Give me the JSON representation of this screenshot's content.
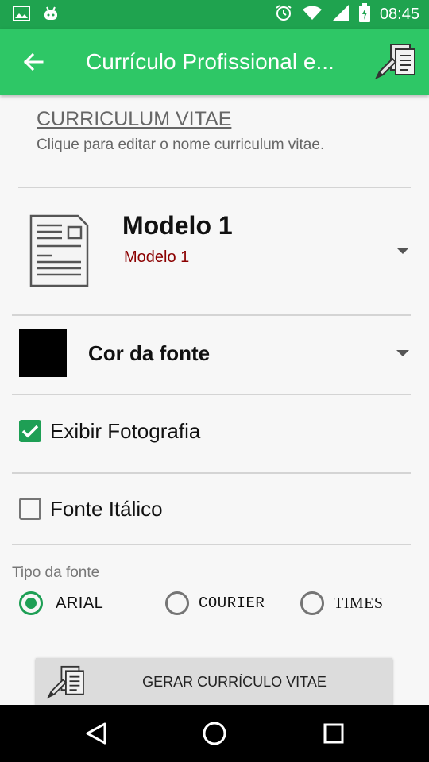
{
  "status_bar": {
    "time": "08:45",
    "icons": [
      "image-icon",
      "android-icon",
      "alarm-icon",
      "wifi-icon",
      "signal-icon",
      "battery-charging-icon"
    ]
  },
  "app_bar": {
    "title": "Currículo Profissional e...",
    "back_icon": "arrow-back-icon",
    "action_icon": "edit-document-icon",
    "background": "#2ec766",
    "status_background": "#1fa34f"
  },
  "cv": {
    "title": "CURRICULUM VITAE",
    "hint": "Clique para editar o nome curriculum vitae."
  },
  "model": {
    "name": "Modelo 1",
    "selected": "Modelo 1"
  },
  "font_color": {
    "label": "Cor da fonte",
    "swatch": "#000000"
  },
  "options": {
    "show_photo": {
      "label": "Exibir Fotografia",
      "checked": true
    },
    "italic": {
      "label": "Fonte Itálico",
      "checked": false
    }
  },
  "font_type": {
    "label": "Tipo da fonte",
    "choices": [
      "ARIAL",
      "COURIER",
      "TIMES"
    ],
    "selected": "ARIAL"
  },
  "generate_button": {
    "label": "GERAR CURRÍCULO VITAE"
  },
  "accent_color": "#1e9f55"
}
